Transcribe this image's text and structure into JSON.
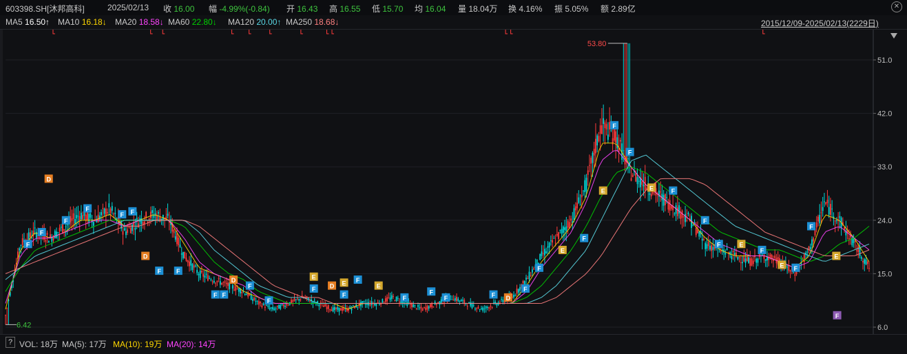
{
  "header": {
    "code": "603398.SH[沐邦高科]",
    "date": "2025/02/13",
    "close_label": "收",
    "close": "16.00",
    "change_label": "幅",
    "change": "-4.99%(-0.84)",
    "open_label": "开",
    "open": "16.43",
    "high_label": "高",
    "high": "16.55",
    "low_label": "低",
    "low": "15.70",
    "avg_label": "均",
    "avg": "16.04",
    "volume": "量 18.04万",
    "turnover": "换 4.16%",
    "amplitude": "振 5.05%",
    "amount": "额 2.89亿"
  },
  "ma_legend": {
    "ma5": "MA5",
    "ma5_val": "16.50↑",
    "ma10": "MA10",
    "ma10_val": "16.18↓",
    "ma20": "MA20",
    "ma20_val": "18.58↓",
    "ma60": "MA60",
    "ma60_val": "22.80↓",
    "ma120": "MA120",
    "ma120_val": "20.00↑",
    "ma250": "MA250",
    "ma250_val": "18.68↓",
    "date_range": "2015/12/09-2025/02/13(2229日)"
  },
  "volume_legend": {
    "q": "?",
    "vol": "VOL: 18万",
    "ma5": "MA(5): 17万",
    "ma10": "MA(10): 19万",
    "ma20": "MA(20): 14万"
  },
  "colors": {
    "up": "#ff3b3b",
    "down": "#00d8d8",
    "ma5": "#ffffff",
    "ma10": "#ffd700",
    "ma20": "#ff44ff",
    "ma60": "#00d000",
    "ma120": "#5ad9e6",
    "ma250": "#ff8080"
  },
  "chart_data": {
    "type": "line",
    "title": "603398.SH[沐邦高科]",
    "ylabel": "",
    "ylim": [
      6.0,
      54.0
    ],
    "y_ticks": [
      6.0,
      15.0,
      24.0,
      33.0,
      42.0,
      51.0
    ],
    "y_tick_labels": [
      "6.0",
      "15.0",
      "24.0",
      "33.0",
      "42.0",
      "51.0"
    ],
    "x_range": [
      "2015/12/09",
      "2025/02/13"
    ],
    "annotations": {
      "max_label": "53.80",
      "min_label": "6.42"
    },
    "series": [
      {
        "name": "MA5",
        "values": [
          8,
          20,
          22,
          21,
          23,
          25,
          24,
          26,
          22,
          24,
          25,
          24,
          18,
          15,
          14,
          13,
          12,
          10,
          9,
          10,
          11,
          10,
          9,
          9,
          10,
          10,
          11,
          10,
          9,
          10,
          11,
          10,
          9,
          10,
          11,
          14,
          18,
          21,
          24,
          30,
          40,
          38,
          32,
          30,
          28,
          26,
          24,
          20,
          19,
          18,
          17,
          18,
          17,
          15,
          19,
          27,
          24,
          20,
          16
        ]
      },
      {
        "name": "MA10",
        "values": [
          9,
          19,
          22,
          21,
          22,
          24,
          24,
          25,
          23,
          24,
          25,
          24,
          20,
          16,
          15,
          14,
          12,
          11,
          10,
          10,
          10,
          10,
          10,
          9,
          10,
          10,
          10,
          10,
          10,
          10,
          10,
          10,
          10,
          10,
          10,
          13,
          17,
          20,
          23,
          28,
          37,
          37,
          33,
          30,
          28,
          26,
          24,
          21,
          19,
          18,
          18,
          18,
          17,
          16,
          18,
          25,
          24,
          21,
          17
        ]
      },
      {
        "name": "MA20",
        "values": [
          10,
          18,
          21,
          21,
          22,
          23,
          24,
          24,
          23,
          24,
          24,
          24,
          21,
          17,
          15,
          14,
          13,
          11,
          10,
          10,
          10,
          10,
          10,
          10,
          10,
          10,
          10,
          10,
          10,
          10,
          10,
          10,
          10,
          10,
          10,
          12,
          16,
          19,
          22,
          27,
          34,
          36,
          33,
          30,
          28,
          26,
          24,
          22,
          20,
          19,
          18,
          18,
          17,
          16,
          17,
          22,
          23,
          21,
          19
        ]
      },
      {
        "name": "MA60",
        "values": [
          12,
          16,
          19,
          20,
          21,
          22,
          23,
          24,
          24,
          24,
          24,
          24,
          23,
          20,
          17,
          15,
          14,
          12,
          11,
          10,
          10,
          10,
          10,
          10,
          10,
          10,
          10,
          10,
          10,
          10,
          10,
          10,
          10,
          10,
          10,
          11,
          13,
          16,
          19,
          23,
          28,
          32,
          33,
          32,
          30,
          28,
          26,
          24,
          22,
          21,
          20,
          19,
          19,
          18,
          17,
          18,
          20,
          21,
          23
        ]
      },
      {
        "name": "MA120",
        "values": [
          14,
          16,
          18,
          19,
          20,
          21,
          22,
          23,
          24,
          24,
          24,
          24,
          24,
          22,
          19,
          17,
          15,
          13,
          12,
          11,
          11,
          10,
          10,
          10,
          10,
          10,
          10,
          10,
          10,
          10,
          10,
          10,
          10,
          10,
          10,
          10,
          11,
          13,
          16,
          19,
          24,
          29,
          34,
          35,
          33,
          31,
          29,
          27,
          25,
          23,
          22,
          21,
          20,
          19,
          18,
          17,
          18,
          19,
          20
        ]
      },
      {
        "name": "MA250",
        "values": [
          15,
          16,
          17,
          18,
          19,
          20,
          21,
          22,
          23,
          23,
          24,
          24,
          24,
          23,
          21,
          19,
          17,
          15,
          13,
          12,
          11,
          11,
          10,
          10,
          10,
          10,
          10,
          10,
          10,
          10,
          10,
          10,
          10,
          10,
          10,
          10,
          10,
          11,
          13,
          15,
          18,
          22,
          26,
          29,
          31,
          31,
          31,
          30,
          28,
          26,
          24,
          22,
          21,
          20,
          19,
          18,
          18,
          18,
          19
        ]
      }
    ],
    "signal_markers": [
      {
        "t": 0.026,
        "y": 20,
        "letter": "F"
      },
      {
        "t": 0.042,
        "y": 22,
        "letter": "F"
      },
      {
        "t": 0.05,
        "y": 31,
        "letter": "D"
      },
      {
        "t": 0.07,
        "y": 24,
        "letter": "F"
      },
      {
        "t": 0.095,
        "y": 26,
        "letter": "F"
      },
      {
        "t": 0.135,
        "y": 25,
        "letter": "F"
      },
      {
        "t": 0.147,
        "y": 25.5,
        "letter": "F"
      },
      {
        "t": 0.162,
        "y": 18,
        "letter": "D"
      },
      {
        "t": 0.178,
        "y": 15.5,
        "letter": "F"
      },
      {
        "t": 0.2,
        "y": 15.5,
        "letter": "F"
      },
      {
        "t": 0.243,
        "y": 11.5,
        "letter": "F"
      },
      {
        "t": 0.253,
        "y": 11.5,
        "letter": "F"
      },
      {
        "t": 0.264,
        "y": 14,
        "letter": "D"
      },
      {
        "t": 0.283,
        "y": 13,
        "letter": "F"
      },
      {
        "t": 0.305,
        "y": 10.5,
        "letter": "F"
      },
      {
        "t": 0.357,
        "y": 14.5,
        "letter": "E"
      },
      {
        "t": 0.357,
        "y": 12.5,
        "letter": "F"
      },
      {
        "t": 0.378,
        "y": 13,
        "letter": "D"
      },
      {
        "t": 0.392,
        "y": 13.5,
        "letter": "E"
      },
      {
        "t": 0.392,
        "y": 11.5,
        "letter": "F"
      },
      {
        "t": 0.408,
        "y": 14,
        "letter": "F"
      },
      {
        "t": 0.432,
        "y": 13,
        "letter": "E"
      },
      {
        "t": 0.462,
        "y": 11,
        "letter": "F"
      },
      {
        "t": 0.493,
        "y": 12,
        "letter": "F"
      },
      {
        "t": 0.51,
        "y": 11,
        "letter": "F"
      },
      {
        "t": 0.565,
        "y": 11.5,
        "letter": "F"
      },
      {
        "t": 0.582,
        "y": 11,
        "letter": "D"
      },
      {
        "t": 0.602,
        "y": 12.5,
        "letter": "F"
      },
      {
        "t": 0.618,
        "y": 16,
        "letter": "F"
      },
      {
        "t": 0.645,
        "y": 19,
        "letter": "E"
      },
      {
        "t": 0.67,
        "y": 21,
        "letter": "F"
      },
      {
        "t": 0.692,
        "y": 29,
        "letter": "E"
      },
      {
        "t": 0.705,
        "y": 40,
        "letter": "F"
      },
      {
        "t": 0.723,
        "y": 35.5,
        "letter": "F"
      },
      {
        "t": 0.748,
        "y": 29.5,
        "letter": "E"
      },
      {
        "t": 0.773,
        "y": 29,
        "letter": "F"
      },
      {
        "t": 0.81,
        "y": 24,
        "letter": "F"
      },
      {
        "t": 0.826,
        "y": 20,
        "letter": "F"
      },
      {
        "t": 0.852,
        "y": 20,
        "letter": "E"
      },
      {
        "t": 0.876,
        "y": 19,
        "letter": "F"
      },
      {
        "t": 0.899,
        "y": 16.5,
        "letter": "E"
      },
      {
        "t": 0.915,
        "y": 16,
        "letter": "F"
      },
      {
        "t": 0.933,
        "y": 23,
        "letter": "F"
      },
      {
        "t": 0.962,
        "y": 18,
        "letter": "E"
      },
      {
        "t": 0.963,
        "y": 8,
        "letter": "F"
      }
    ],
    "top_ticks": [
      0.055,
      0.168,
      0.182,
      0.262,
      0.282,
      0.306,
      0.342,
      0.372,
      0.378,
      0.579,
      0.585,
      0.877
    ],
    "grid": true,
    "legend": "top-left"
  }
}
